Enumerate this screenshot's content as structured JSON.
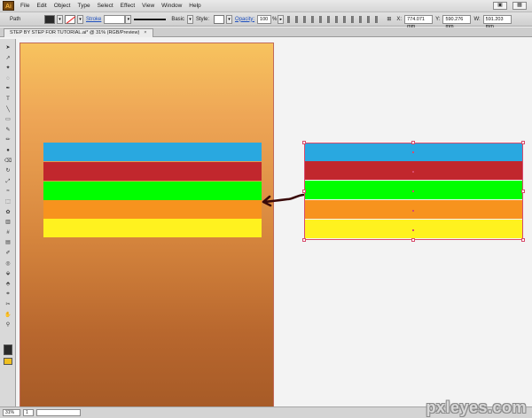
{
  "app": {
    "logo": "Ai"
  },
  "menu": {
    "items": [
      "File",
      "Edit",
      "Object",
      "Type",
      "Select",
      "Effect",
      "View",
      "Window",
      "Help"
    ]
  },
  "control_bar": {
    "selection_type": "Path",
    "stroke_label": "Stroke",
    "brush": "Basic",
    "style_label": "Style:",
    "opacity_label": "Opacity:",
    "opacity_value": "100",
    "opacity_unit": "%",
    "x_value": "774.071 mm",
    "y_value": "590.276 mm",
    "w_value": "591.203 mm"
  },
  "document": {
    "tab_title": "STEP BY STEP FOR TUTORIAL.ai* @ 31% (RGB/Preview)",
    "close": "×"
  },
  "tools": {
    "icons": [
      "selection-tool",
      "direct-selection-tool",
      "magic-wand-tool",
      "lasso-tool",
      "pen-tool",
      "type-tool",
      "line-tool",
      "rectangle-tool",
      "paintbrush-tool",
      "pencil-tool",
      "blob-brush-tool",
      "eraser-tool",
      "rotate-tool",
      "scale-tool",
      "warp-tool",
      "free-transform-tool",
      "symbol-sprayer-tool",
      "column-graph-tool",
      "mesh-tool",
      "gradient-tool",
      "eyedropper-tool",
      "blend-tool",
      "live-paint-tool",
      "live-paint-selection-tool",
      "crop-tool",
      "slice-tool",
      "hand-tool",
      "zoom-tool"
    ]
  },
  "canvas": {
    "artboard_gradient": [
      "#f7c35e",
      "#a75b27"
    ],
    "stripes": [
      "#29a8e0",
      "#c1272d",
      "#00ff00",
      "#f7931e",
      "#fff21f"
    ],
    "selection_color": "#d84a6c",
    "arrow_color": "#3a0a0a"
  },
  "status": {
    "zoom": "31%",
    "page": "1"
  },
  "watermark": "pxleyes.com"
}
